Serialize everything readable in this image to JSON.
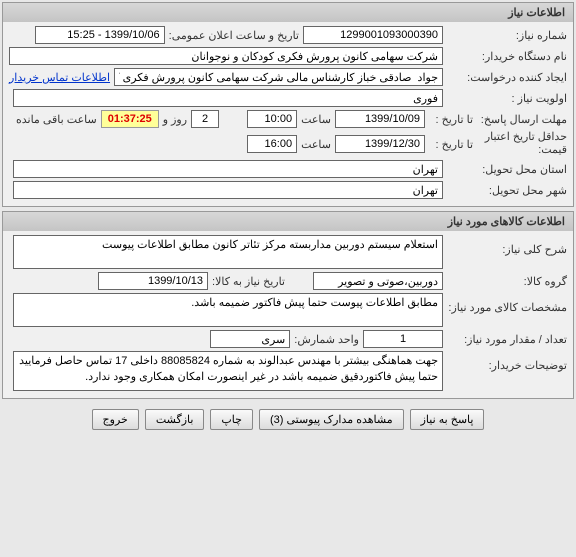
{
  "panel1": {
    "title": "اطلاعات نیاز",
    "need_number_label": "شماره نیاز:",
    "need_number": "1299001093000390",
    "public_date_label": "تاریخ و ساعت اعلان عمومی:",
    "public_date": "1399/10/06 - 15:25",
    "org_label": "نام دستگاه خریدار:",
    "org": "شرکت سهامی کانون پرورش فکری کودکان و نوجوانان",
    "requester_label": "ایجاد کننده درخواست:",
    "requester": "جواد  صادقی خباز کارشناس مالی شرکت سهامی کانون پرورش فکری کودکان و",
    "contact_link": "اطلاعات تماس خریدار",
    "priority_label": "اولویت نیاز :",
    "priority": "فوری",
    "deadline_label": "مهلت ارسال پاسخ:",
    "to_date_label": "تا تاریخ :",
    "deadline_date": "1399/10/09",
    "time_label": "ساعت",
    "deadline_time": "10:00",
    "days": "2",
    "days_suffix": "روز و",
    "countdown": "01:37:25",
    "remain_suffix": "ساعت باقی مانده",
    "min_valid_label_a": "حداقل تاریخ اعتبار",
    "min_valid_label_b": "قیمت:",
    "min_valid_to_label": "تا تاریخ :",
    "min_valid_date": "1399/12/30",
    "min_valid_time": "16:00",
    "delivery_province_label": "استان محل تحویل:",
    "delivery_province": "تهران",
    "delivery_city_label": "شهر محل تحویل:",
    "delivery_city": "تهران"
  },
  "panel2": {
    "title": "اطلاعات کالاهای مورد نیاز",
    "general_desc_label": "شرح کلی نیاز:",
    "general_desc": "استعلام سیستم دوربین مداربسته مرکز تئاتر کانون مطابق اطلاعات پیوست",
    "goods_group_label": "گروه کالا:",
    "goods_group": "دوربین،صوتی و تصویر",
    "delivery_to_label": "تاریخ نیاز به کالا:",
    "delivery_to_date": "1399/10/13",
    "goods_spec_label": "مشخصات کالای مورد نیاز:",
    "goods_spec": "مطابق اطلاعات پیوست حتما پیش فاکتور ضمیمه باشد.",
    "qty_label": "تعداد / مقدار مورد نیاز:",
    "qty": "1",
    "unit_label": "واحد شمارش:",
    "unit": "سری",
    "notes_label": "توضیحات خریدار:",
    "notes": "جهت هماهنگی بیشتر با مهندس عبدالوند به شماره 88085824 داخلی 17 تماس حاصل فرمایید حتما پیش فاکتوردقیق ضمیمه باشد در غیر اینصورت امکان همکاری وجود ندارد."
  },
  "buttons": {
    "respond": "پاسخ به نیاز",
    "attachments": "مشاهده مدارک پیوستی  (3)",
    "print": "چاپ",
    "back": "بازگشت",
    "exit": "خروج"
  }
}
